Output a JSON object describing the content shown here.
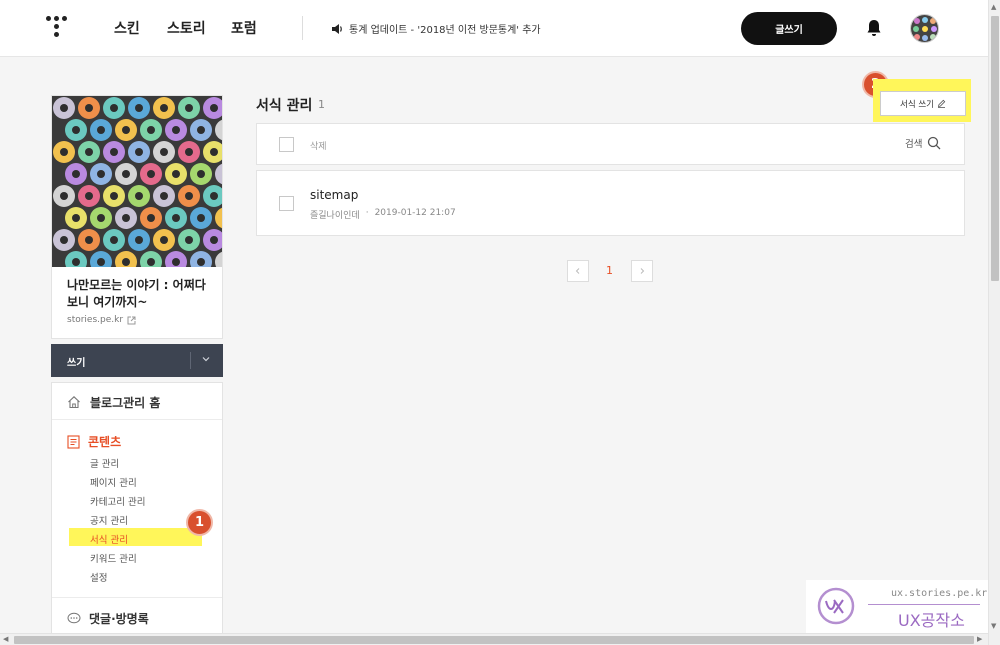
{
  "topnav": {
    "links": [
      "스킨",
      "스토리",
      "포럼"
    ],
    "notice": "통계 업데이트 - '2018년 이전 방문통계' 추가",
    "write_button": "글쓰기"
  },
  "sidebar": {
    "blog_title": "나만모르는 이야기 : 어쩌다 보니 여기까지~",
    "blog_url": "stories.pe.kr",
    "write_bar_label": "쓰기",
    "home_label": "블로그관리 홈",
    "content_section": "콘텐츠",
    "content_items": [
      "글 관리",
      "페이지 관리",
      "카테고리 관리",
      "공지 관리",
      "서식 관리",
      "키워드 관리",
      "설정"
    ],
    "active_item": "서식 관리",
    "comments_section": "댓글·방명록"
  },
  "main": {
    "heading": "서식 관리",
    "count": "1",
    "new_form_button": "서식 쓰기",
    "delete_label": "삭제",
    "search_label": "검색",
    "items": [
      {
        "title": "sitemap",
        "author": "즐길나이인데",
        "date": "2019-01-12 21:07"
      }
    ],
    "current_page": "1"
  },
  "annotations": {
    "badge_1": "1",
    "badge_2": "2"
  },
  "watermark": {
    "url": "ux.stories.pe.kr",
    "name": "UX공작소"
  },
  "colors": {
    "accent": "#e74e25",
    "highlight": "#fff65a",
    "write_bar": "#3d4451",
    "badge": "#d9502e"
  }
}
